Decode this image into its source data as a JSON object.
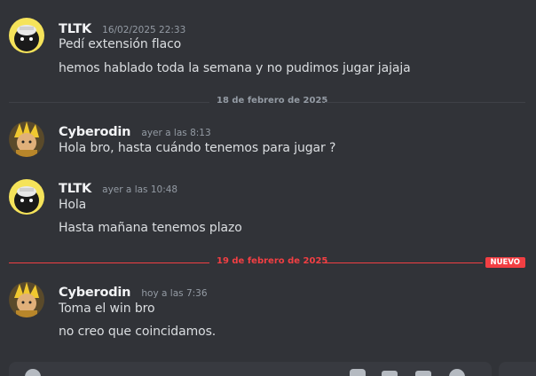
{
  "colors": {
    "background": "#313338",
    "username": "#f2f3f5",
    "text": "#dbdee1",
    "muted": "#949ba4",
    "new_accent": "#f23f43"
  },
  "groups": [
    {
      "username": "TLTK",
      "timestamp": "16/02/2025 22:33",
      "avatar_icon": "bear-with-hat-avatar",
      "lines": [
        "Pedí extensión flaco",
        "hemos hablado toda la semana y no pudimos jugar jajaja"
      ]
    },
    {
      "username": "Cyberodin",
      "timestamp": "ayer a las 8:13",
      "avatar_icon": "anime-character-avatar",
      "lines": [
        "Hola bro, hasta cuándo tenemos para jugar ?"
      ]
    },
    {
      "username": "TLTK",
      "timestamp": "ayer a las 10:48",
      "avatar_icon": "bear-with-hat-avatar",
      "lines": [
        "Hola",
        "Hasta mañana tenemos plazo"
      ]
    },
    {
      "username": "Cyberodin",
      "timestamp": "hoy a las 7:36",
      "avatar_icon": "anime-character-avatar",
      "lines": [
        "Toma el win bro",
        "no creo que coincidamos."
      ]
    }
  ],
  "dividers": [
    {
      "date": "18 de febrero de 2025"
    },
    {
      "date": "19 de febrero de 2025",
      "badge": "NUEVO"
    }
  ]
}
